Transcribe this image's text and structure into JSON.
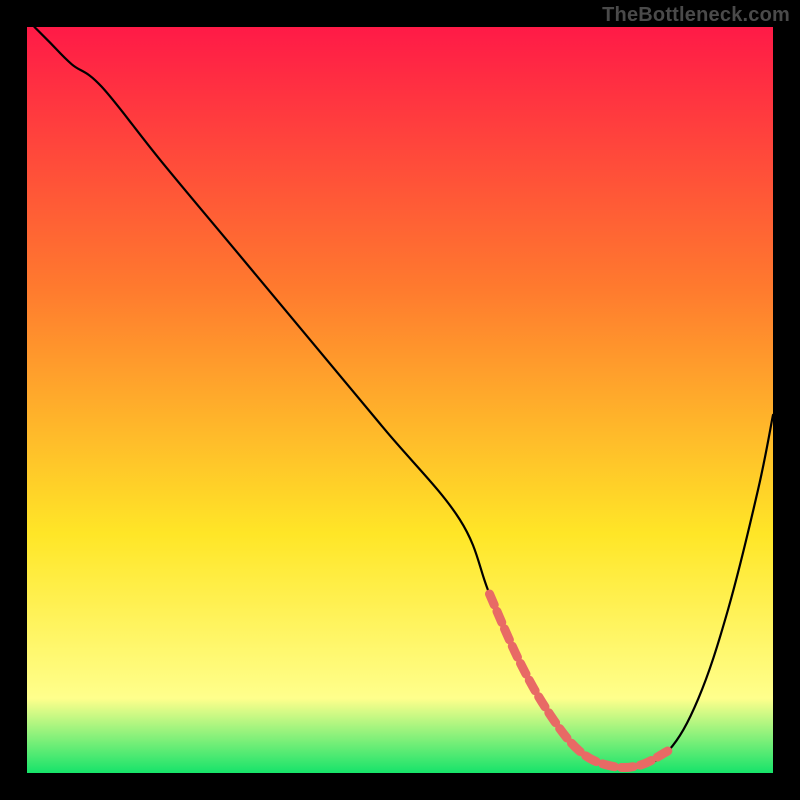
{
  "watermark": "TheBottleneck.com",
  "chart_data": {
    "type": "line",
    "title": "",
    "xlabel": "",
    "ylabel": "",
    "xlim": [
      0,
      100
    ],
    "ylim": [
      0,
      100
    ],
    "grid": false,
    "gradient": {
      "top": "#ff1a47",
      "mid1": "#ff7a2e",
      "mid2": "#ffe627",
      "mid3": "#ffff8c",
      "bottom": "#16e36a"
    },
    "series": [
      {
        "name": "main-curve",
        "color": "#000000",
        "x": [
          1,
          3,
          6,
          10,
          18,
          28,
          38,
          48,
          58,
          62,
          66,
          70,
          74,
          78,
          82,
          86,
          90,
          94,
          98,
          100
        ],
        "y": [
          100,
          98,
          95,
          92,
          82,
          70,
          58,
          46,
          34,
          24,
          15,
          8,
          3,
          1,
          1,
          3,
          10,
          22,
          38,
          48
        ]
      },
      {
        "name": "highlight-segment",
        "color": "#e86a65",
        "x": [
          62,
          66,
          70,
          74,
          78,
          82,
          86
        ],
        "y": [
          24,
          15,
          8,
          3,
          1,
          1,
          3
        ],
        "markers": true
      }
    ]
  }
}
